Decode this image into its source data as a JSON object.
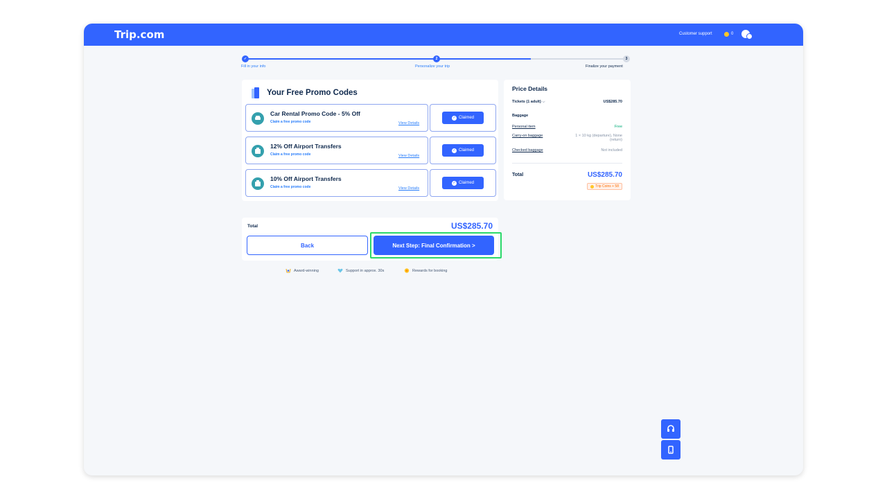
{
  "header": {
    "logo": "Trip.com",
    "support": "Customer support",
    "coins": "0"
  },
  "stepper": {
    "steps": [
      {
        "label": "Fill in your info",
        "state": "done"
      },
      {
        "label": "Personalize your trip",
        "state": "current",
        "number": "2"
      },
      {
        "label": "Finalize your payment",
        "state": "upcoming",
        "number": "3"
      }
    ]
  },
  "promo": {
    "title": "Your Free Promo Codes",
    "items": [
      {
        "name": "Car Rental Promo Code - 5% Off",
        "sub": "Claim a free promo code",
        "details": "View Details",
        "button": "Claimed",
        "icon": "car-icon"
      },
      {
        "name": "12% Off Airport Transfers",
        "sub": "Claim a free promo code",
        "details": "View Details",
        "button": "Claimed",
        "icon": "airport-transfer-icon"
      },
      {
        "name": "10% Off Airport Transfers",
        "sub": "Claim a free promo code",
        "details": "View Details",
        "button": "Claimed",
        "icon": "airport-transfer-icon"
      }
    ]
  },
  "price": {
    "title": "Price Details",
    "tickets_label": "Tickets  (1 adult)",
    "tickets_value": "US$285.70",
    "baggage_heading": "Baggage",
    "personal_item_label": "Personal item",
    "personal_item_value": "Free",
    "carry_on_label": "Carry-on baggage",
    "carry_on_value_1": "1 × 10 kg (departure), None",
    "carry_on_value_2": "(return)",
    "checked_label": "Checked baggage",
    "checked_value": "Not included",
    "total_label": "Total",
    "total_value": "US$285.70",
    "coins_badge": "Trip Coins + 58"
  },
  "footer_bar": {
    "total_label": "Total",
    "total_value": "US$285.70",
    "back": "Back",
    "next": "Next Step: Final Confirmation >"
  },
  "features": [
    "Award-winning",
    "Support in approx. 30s",
    "Rewards for booking"
  ],
  "colors": {
    "brand": "#3264ff",
    "highlight": "#2bd96a",
    "coin": "#ffc627"
  }
}
